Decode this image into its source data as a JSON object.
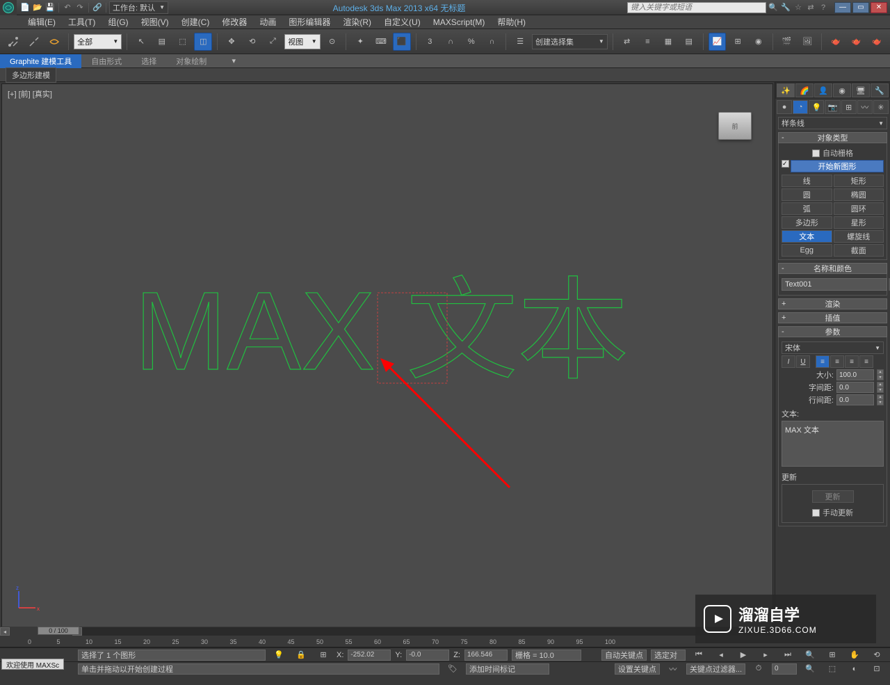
{
  "app": {
    "title": "Autodesk 3ds Max  2013 x64     无标题",
    "workspace_label": "工作台: 默认",
    "search_placeholder": "键入关键字或短语"
  },
  "menu": [
    "编辑(E)",
    "工具(T)",
    "组(G)",
    "视图(V)",
    "创建(C)",
    "修改器",
    "动画",
    "图形编辑器",
    "渲染(R)",
    "自定义(U)",
    "MAXScript(M)",
    "帮助(H)"
  ],
  "toolbar": {
    "filter_dd": "全部",
    "view_dd": "视图",
    "named_set_dd": "创建选择集"
  },
  "ribbon": {
    "tabs": [
      "Graphite 建模工具",
      "自由形式",
      "选择",
      "对象绘制"
    ],
    "sub": "多边形建模"
  },
  "viewport": {
    "label": "[+] [前] [真实]",
    "cube": "前",
    "text_outline": "MAX 文本"
  },
  "cmd": {
    "category_dd": "样条线",
    "rollouts": {
      "obj_type": "对象类型",
      "auto_grid": "自动栅格",
      "start_new": "开始新图形",
      "obj_buttons": [
        "线",
        "矩形",
        "圆",
        "椭圆",
        "弧",
        "圆环",
        "多边形",
        "星形",
        "文本",
        "螺旋线",
        "Egg",
        "截面"
      ],
      "name_color": "名称和颜色",
      "name_value": "Text001",
      "render": "渲染",
      "interp": "插值",
      "params": "参数",
      "font_dd": "宋体",
      "size_lbl": "大小:",
      "size_val": "100.0",
      "kerning_lbl": "字间距:",
      "kerning_val": "0.0",
      "leading_lbl": "行间距:",
      "leading_val": "0.0",
      "text_lbl": "文本:",
      "text_val": "MAX 文本",
      "update_hdr": "更新",
      "update_btn": "更新",
      "manual_upd": "手动更新"
    }
  },
  "timeline": {
    "slider": "0 / 100",
    "ticks": [
      "0",
      "5",
      "10",
      "15",
      "20",
      "25",
      "30",
      "35",
      "40",
      "45",
      "50",
      "55",
      "60",
      "65",
      "70",
      "75",
      "80",
      "85",
      "90",
      "95",
      "100"
    ]
  },
  "status": {
    "selected": "选择了 1 个图形",
    "prompt": "单击并拖动以开始创建过程",
    "x": "-252.02",
    "y": "-0.0",
    "z": "166.546",
    "grid": "栅格 = 10.0",
    "add_tag": "添加时间标记",
    "autokey": "自动关键点",
    "selected_set": "选定对",
    "setkey": "设置关键点",
    "keyfilter": "关键点过滤器...",
    "frame": "0",
    "welcome": "欢迎使用  MAXSc"
  },
  "watermark": {
    "title": "溜溜自学",
    "url": "ZIXUE.3D66.COM"
  }
}
